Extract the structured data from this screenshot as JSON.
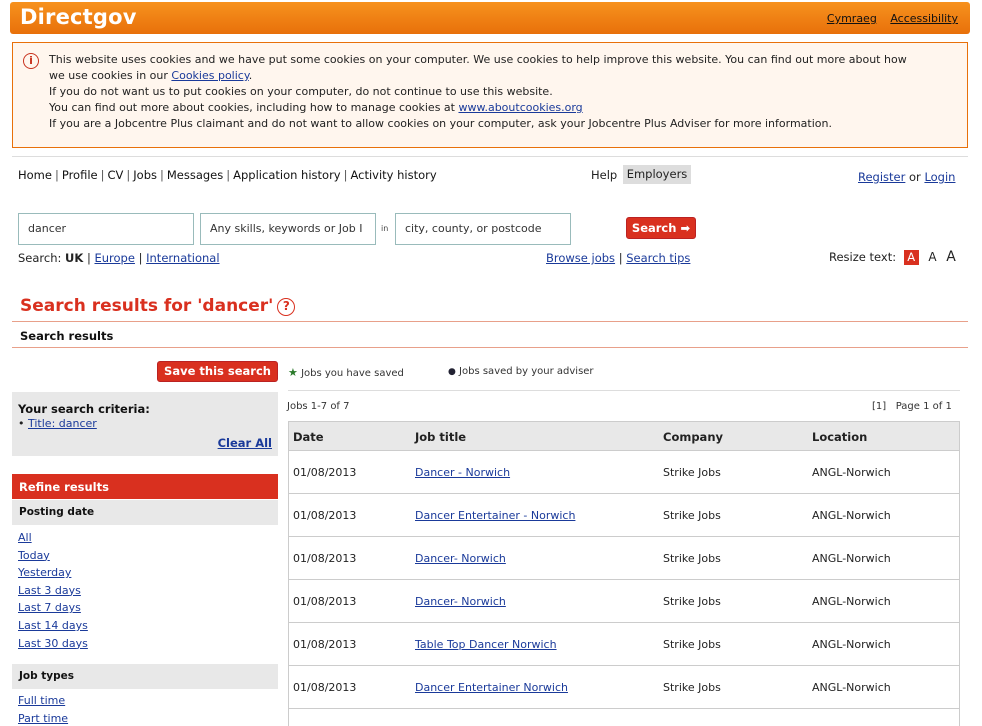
{
  "header": {
    "logo": "Directgov",
    "links": [
      "Cymraeg",
      "Accessibility"
    ]
  },
  "cookie_notice": {
    "lines": [
      "This website uses cookies and we have put some cookies on your computer. We use cookies to help improve this website. You can find out more about how",
      "we use cookies in our",
      "If you do not want us to put cookies on your computer, do not continue to use this website.",
      "You can find out more about cookies, including how to manage cookies at",
      "If you are a Jobcentre Plus claimant and do not want to allow cookies on your computer, ask your Jobcentre Plus Adviser for more information."
    ],
    "policy_link": "Cookies policy",
    "about_link": "www.aboutcookies.org"
  },
  "nav": {
    "items": [
      "Home",
      "Profile",
      "CV",
      "Jobs",
      "Messages",
      "Application history",
      "Activity history"
    ],
    "help": "Help",
    "employers": "Employers",
    "register": "Register",
    "or": "or",
    "login": "Login"
  },
  "search": {
    "keyword_value": "dancer",
    "skills_placeholder": "Any skills, keywords or Job I",
    "in_label": "in",
    "location_placeholder": "city, county, or postcode",
    "button": "Search",
    "scope_label": "Search:",
    "scope_current": "UK",
    "scopes": [
      "Europe",
      "International"
    ],
    "browse_jobs": "Browse jobs",
    "search_tips": "Search tips",
    "resize_label": "Resize text:",
    "resize_a": "A"
  },
  "results": {
    "title": "Search results for 'dancer'",
    "subtitle": "Search results",
    "save_search": "Save this search",
    "legend_saved": "Jobs you have saved",
    "legend_adviser": "Jobs saved by your adviser",
    "count": "Jobs 1-7 of 7",
    "pager_current": "[1]",
    "page_of": "Page 1 of 1",
    "columns": [
      "Date",
      "Job title",
      "Company",
      "Location"
    ],
    "rows": [
      {
        "date": "01/08/2013",
        "title": "Dancer - Norwich",
        "company": "Strike Jobs",
        "location": "ANGL-Norwich"
      },
      {
        "date": "01/08/2013",
        "title": "Dancer Entertainer - Norwich",
        "company": "Strike Jobs",
        "location": "ANGL-Norwich"
      },
      {
        "date": "01/08/2013",
        "title": "Dancer- Norwich",
        "company": "Strike Jobs",
        "location": "ANGL-Norwich"
      },
      {
        "date": "01/08/2013",
        "title": "Dancer- Norwich",
        "company": "Strike Jobs",
        "location": "ANGL-Norwich"
      },
      {
        "date": "01/08/2013",
        "title": "Table Top Dancer Norwich",
        "company": "Strike Jobs",
        "location": "ANGL-Norwich"
      },
      {
        "date": "01/08/2013",
        "title": "Dancer Entertainer Norwich",
        "company": "Strike Jobs",
        "location": "ANGL-Norwich"
      }
    ]
  },
  "sidebar": {
    "criteria_heading": "Your search criteria:",
    "criteria_item": "Title: dancer",
    "clear_all": "Clear All",
    "refine": "Refine results",
    "posting_date_heading": "Posting date",
    "posting_dates": [
      "All",
      "Today",
      "Yesterday",
      "Last 3 days",
      "Last 7 days",
      "Last 14 days",
      "Last 30 days"
    ],
    "job_types_heading": "Job types",
    "job_types": [
      "Full time",
      "Part time"
    ]
  },
  "colors": {
    "brand_orange": "#e8700a",
    "accent_red": "#d9301f"
  }
}
